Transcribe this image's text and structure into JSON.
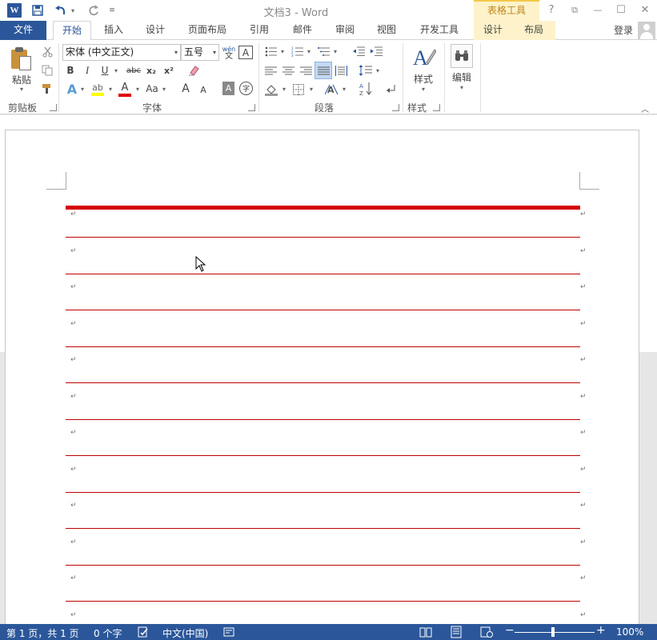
{
  "app": {
    "title": "文档3 - Word",
    "logo_letter": "W",
    "context_tab_group": "表格工具"
  },
  "quick_access": {
    "save_icon": "save-icon",
    "undo_icon": "undo-icon",
    "redo_icon": "redo-icon",
    "customize_icon": "customize-icon"
  },
  "window_controls": {
    "help": "?",
    "ribbon_options": "⧉",
    "minimize": "—",
    "maximize": "☐",
    "close": "✕"
  },
  "tabs": {
    "file": "文件",
    "home": "开始",
    "insert": "插入",
    "design": "设计",
    "layout": "页面布局",
    "references": "引用",
    "mailings": "邮件",
    "review": "审阅",
    "view": "视图",
    "developer": "开发工具",
    "table_design": "设计",
    "table_layout": "布局"
  },
  "account": {
    "login": "登录"
  },
  "ribbon": {
    "clipboard": {
      "label": "剪贴板",
      "paste": "粘贴"
    },
    "font": {
      "label": "字体",
      "font_name": "宋体 (中文正文)",
      "font_size": "五号",
      "phonetic_top": "wén",
      "phonetic_bottom": "文",
      "border_char": "A",
      "bold": "B",
      "italic": "I",
      "underline": "U",
      "strike": "abc",
      "subscript": "x₂",
      "superscript": "x²",
      "grow": "A",
      "shrink": "A",
      "change_case": "Aa",
      "shading_char": "A",
      "enclose_char": "字"
    },
    "paragraph": {
      "label": "段落"
    },
    "styles": {
      "label": "样式",
      "button": "样式"
    },
    "editing": {
      "button": "编辑"
    }
  },
  "document": {
    "paragraph_mark": "↵",
    "rows": 12
  },
  "colors": {
    "accent": "#2b579a",
    "table_border": "#c00000",
    "context_tab": "#fdf2c9"
  },
  "status": {
    "page": "第 1 页，共 1 页",
    "words": "0 个字",
    "language": "中文(中国)",
    "zoom": "100%"
  }
}
